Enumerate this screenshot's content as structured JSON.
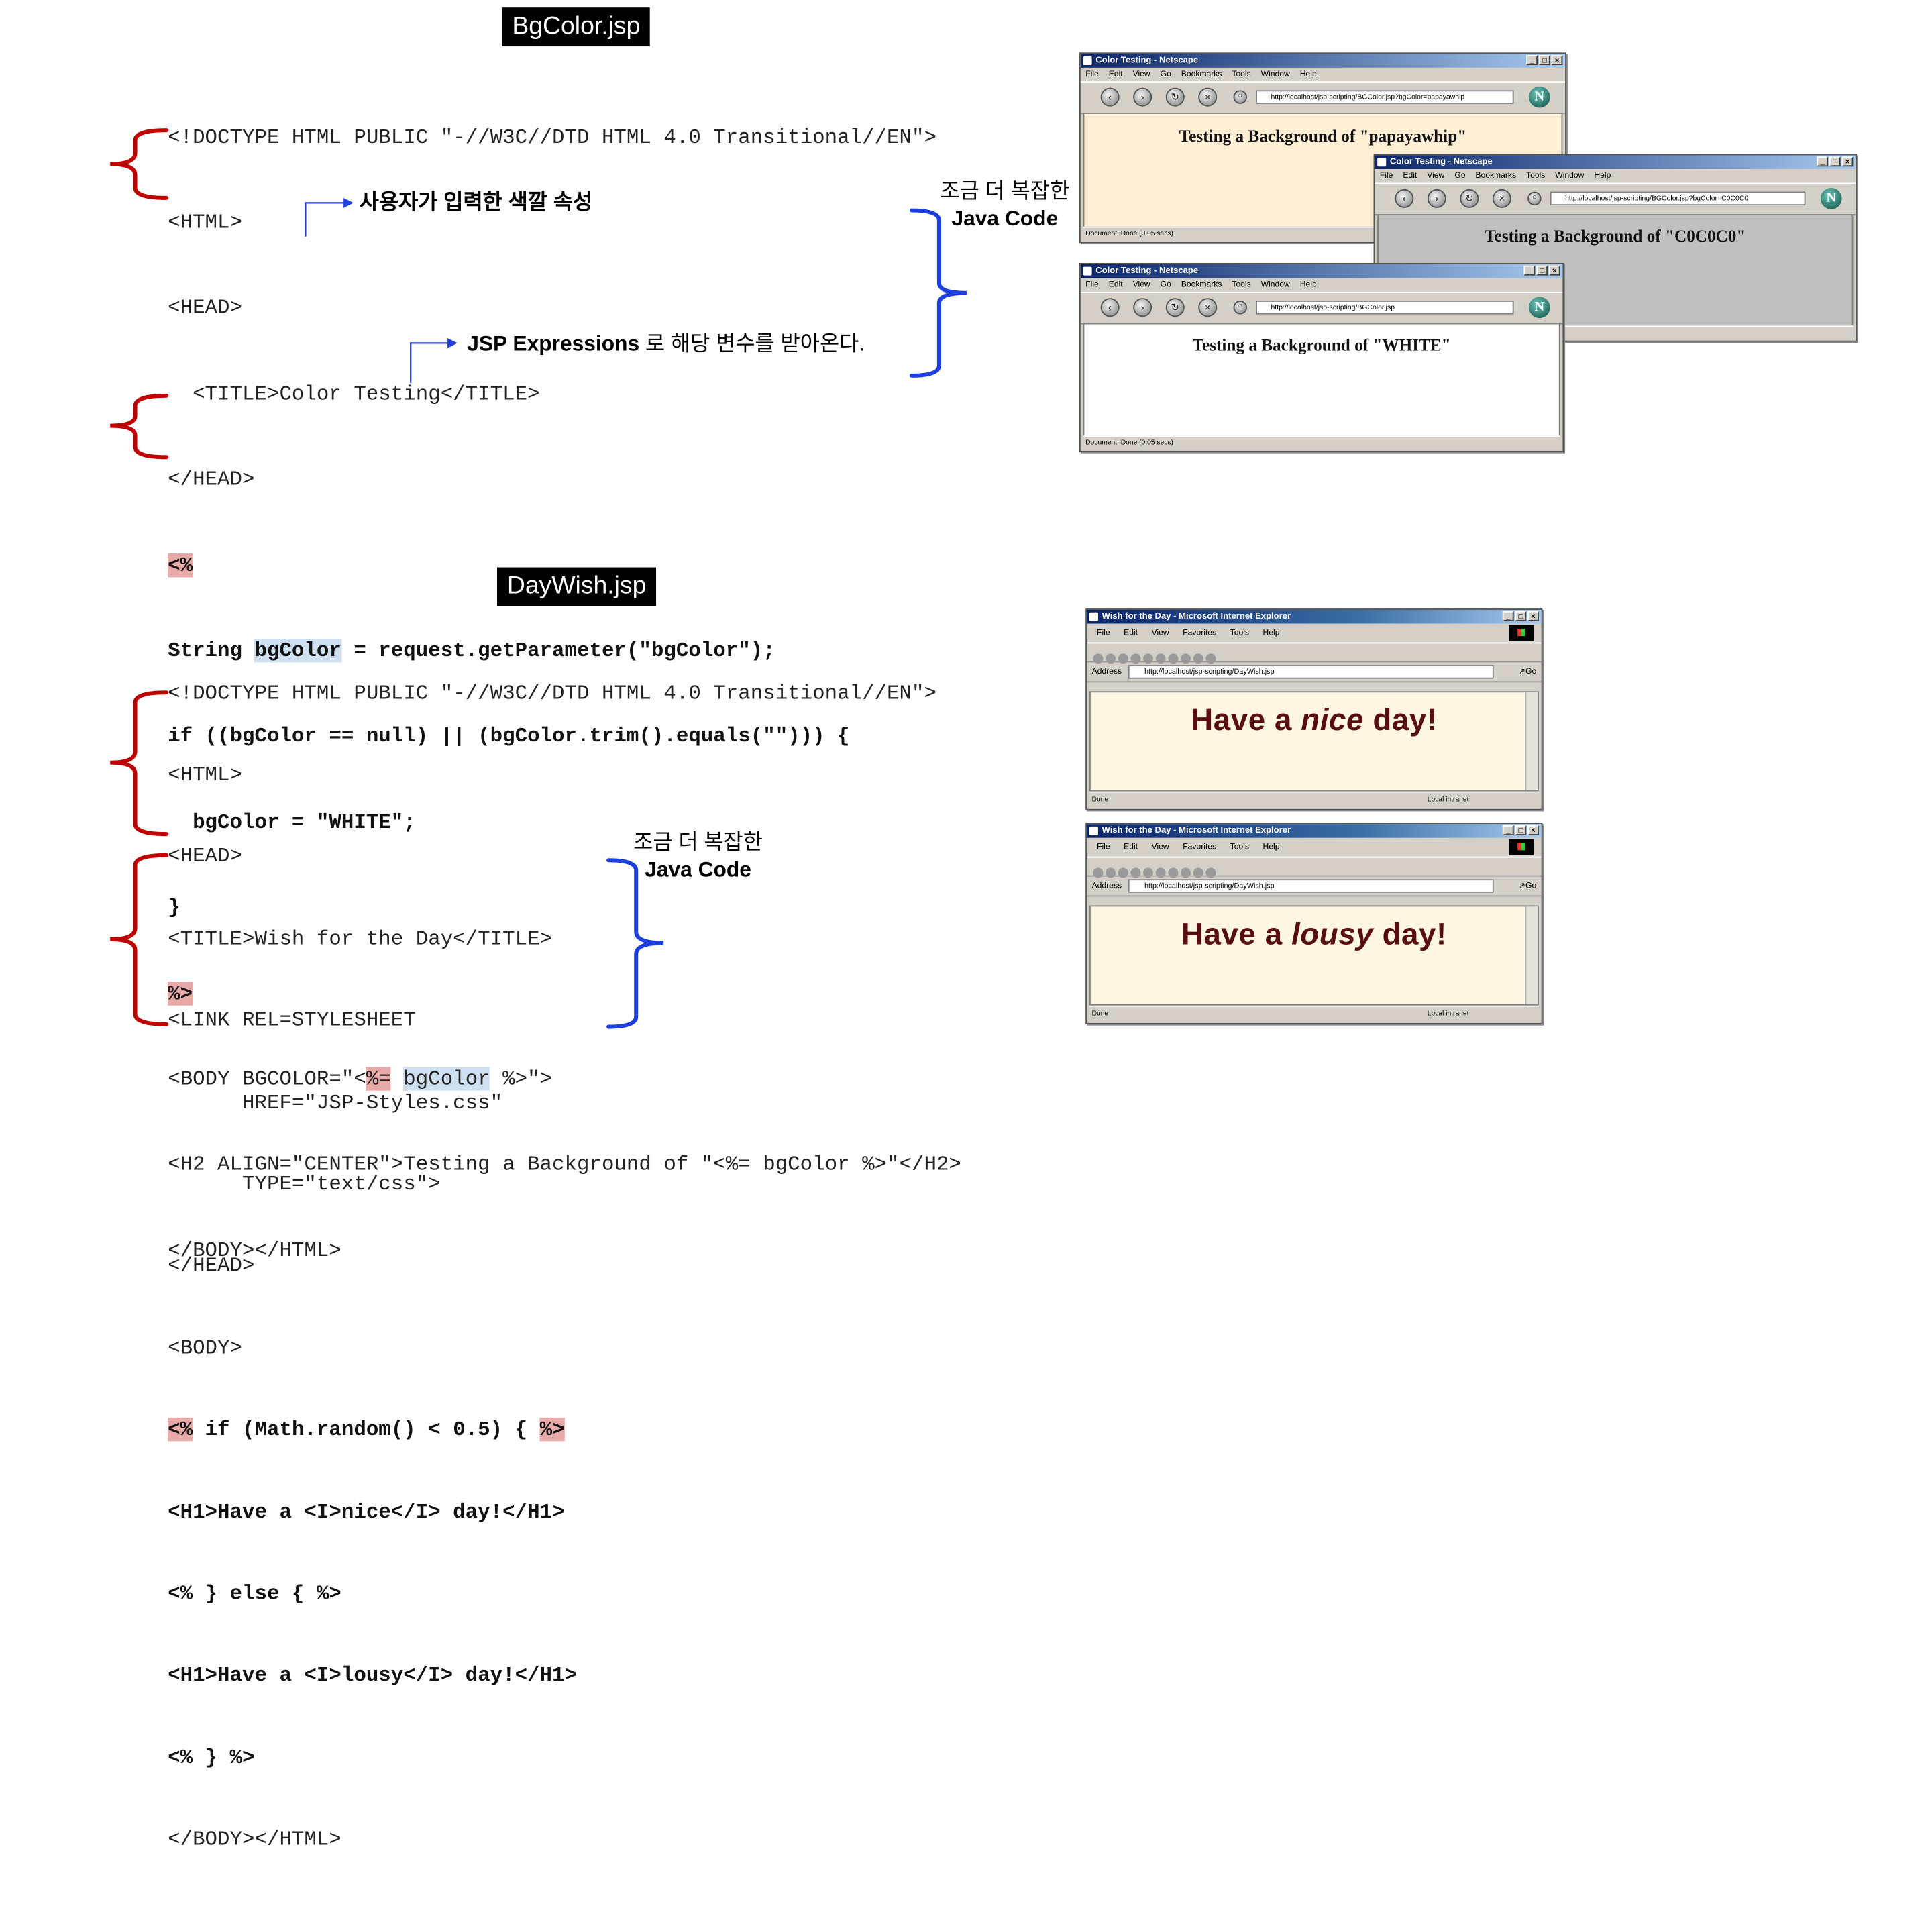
{
  "bgcolor_section": {
    "file_label": "BgColor.jsp",
    "code": {
      "l1": "<!DOCTYPE HTML PUBLIC \"-//W3C//DTD HTML 4.0 Transitional//EN\">",
      "l2": "<HTML>",
      "l3": "<HEAD>",
      "l4": "  <TITLE>Color Testing</TITLE>",
      "l5": "</HEAD>",
      "l6": "<%",
      "l7a": "String ",
      "l7b": "bgColor",
      "l7c": " = request.getParameter(\"bgColor\");",
      "l8": "if ((bgColor == null) || (bgColor.trim().equals(\"\"))) {",
      "l9": "  bgColor = \"WHITE\";",
      "l10": "}",
      "l11": "%>",
      "l12a": "<BODY BGCOLOR=\"<",
      "l12b": "%=",
      "l12c": " ",
      "l12d": "bgColor",
      "l12e": " %>\">",
      "l13": "<H2 ALIGN=\"CENTER\">Testing a Background of \"<%= bgColor %>\"</H2>",
      "l14": "</BODY></HTML>"
    },
    "annotations": {
      "user_color": "사용자가 입력한 색깔 속성",
      "jsp_expr_a": "JSP Expressions",
      "jsp_expr_b": " 로 해당 변수를 받아온다.",
      "complex_a": "조금 더 복잡한",
      "complex_b": "Java Code"
    },
    "browsers": [
      {
        "title": "Color Testing - Netscape",
        "url": "http://localhost/jsp-scripting/BGColor.jsp?bgColor=papayawhip",
        "content": "Testing a Background of \"papayawhip\"",
        "status": "Document: Done (0.05 secs)",
        "bg": "#ffefd5"
      },
      {
        "title": "Color Testing - Netscape",
        "url": "http://localhost/jsp-scripting/BGColor.jsp?bgColor=C0C0C0",
        "content": "Testing a Background of \"C0C0C0\"",
        "status": "",
        "bg": "#c0c0c0"
      },
      {
        "title": "Color Testing - Netscape",
        "url": "http://localhost/jsp-scripting/BGColor.jsp",
        "content": "Testing a Background of \"WHITE\"",
        "status": "Document: Done (0.05 secs)",
        "bg": "#ffffff"
      }
    ],
    "netscape_menu": [
      "File",
      "Edit",
      "View",
      "Go",
      "Bookmarks",
      "Tools",
      "Window",
      "Help"
    ]
  },
  "daywish_section": {
    "file_label": "DayWish.jsp",
    "code": {
      "l1": "<!DOCTYPE HTML PUBLIC \"-//W3C//DTD HTML 4.0 Transitional//EN\">",
      "l2": "<HTML>",
      "l3": "<HEAD>",
      "l4": "<TITLE>Wish for the Day</TITLE>",
      "l5": "<LINK REL=STYLESHEET",
      "l6": "      HREF=\"JSP-Styles.css\"",
      "l7": "      TYPE=\"text/css\">",
      "l8": "</HEAD>",
      "l9": "<BODY>",
      "l10a": "<%",
      "l10b": " if (Math.random() < 0.5) { ",
      "l10c": "%>",
      "l11": "<H1>Have a <I>nice</I> day!</H1>",
      "l12": "<% } else { %>",
      "l13": "<H1>Have a <I>lousy</I> day!</H1>",
      "l14": "<% } %>",
      "l15": "</BODY></HTML>"
    },
    "annotations": {
      "complex_a": "조금 더 복잡한",
      "complex_b": "Java Code"
    },
    "browsers": [
      {
        "title": "Wish for the Day - Microsoft Internet Explorer",
        "url": "http://localhost/jsp-scripting/DayWish.jsp",
        "wish_a": "Have a ",
        "wish_b": "nice",
        "wish_c": " day!",
        "status_done": "Done",
        "status_zone": "Local intranet"
      },
      {
        "title": "Wish for the Day - Microsoft Internet Explorer",
        "url": "http://localhost/jsp-scripting/DayWish.jsp",
        "wish_a": "Have a ",
        "wish_b": "lousy",
        "wish_c": " day!",
        "status_done": "Done",
        "status_zone": "Local intranet"
      }
    ],
    "ie_menu": [
      "File",
      "Edit",
      "View",
      "Favorites",
      "Tools",
      "Help"
    ],
    "address_label": "Address",
    "go_label": "Go"
  },
  "colors": {
    "highlight_red": "#e8a9a9",
    "highlight_blue": "#cfe0f1",
    "brace_red": "#c00000",
    "brace_blue": "#1d3fe0"
  }
}
